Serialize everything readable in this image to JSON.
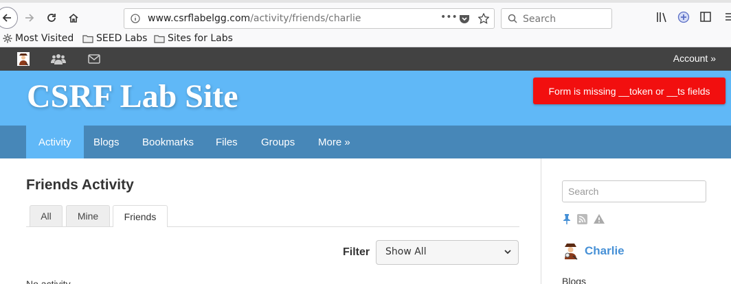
{
  "browser": {
    "url_host": "www.csrflabelgg.com",
    "url_path": "/activity/friends/charlie",
    "search_placeholder": "Search"
  },
  "bookmarks": [
    {
      "label": "Most Visited",
      "icon": "gear-icon"
    },
    {
      "label": "SEED Labs",
      "icon": "folder-icon"
    },
    {
      "label": "Sites for Labs",
      "icon": "folder-icon"
    }
  ],
  "topbar": {
    "account_label": "Account »"
  },
  "site": {
    "title": "CSRF Lab Site",
    "error_message": "Form is missing __token or __ts fields"
  },
  "menu": {
    "items": [
      "Activity",
      "Blogs",
      "Bookmarks",
      "Files",
      "Groups",
      "More »"
    ],
    "active": "Activity"
  },
  "main": {
    "title": "Friends Activity",
    "tabs": [
      "All",
      "Mine",
      "Friends"
    ],
    "selected_tab": "Friends",
    "filter_label": "Filter",
    "filter_value": "Show All",
    "empty_text": "No activity"
  },
  "sidebar": {
    "search_placeholder": "Search",
    "owner_name": "Charlie",
    "blogs_label": "Blogs"
  },
  "colors": {
    "header_blue": "#60b8f7",
    "menu_blue": "#4787b8",
    "topbar": "#424242",
    "error_red": "#f20f0f",
    "link_blue": "#4690d6"
  }
}
